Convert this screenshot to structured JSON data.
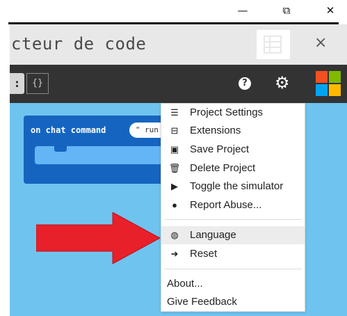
{
  "window": {
    "minimize": "—",
    "restore": "⧉",
    "close": "✕"
  },
  "header": {
    "title": "cteur de code",
    "close": "×"
  },
  "toolbar": {
    "partial_button": ":",
    "js_button": "{}",
    "help": "?"
  },
  "block": {
    "label": "on chat command",
    "value": "\" run \""
  },
  "menu": {
    "items": [
      {
        "label": "Project Settings",
        "icon": "sliders-icon"
      },
      {
        "label": "Extensions",
        "icon": "drawer-icon"
      },
      {
        "label": "Save Project",
        "icon": "floppy-icon"
      },
      {
        "label": "Delete Project",
        "icon": "trash-icon"
      },
      {
        "label": "Toggle the simulator",
        "icon": "play-box-icon"
      },
      {
        "label": "Report Abuse...",
        "icon": "alert-circle-icon"
      },
      {
        "label": "Language",
        "icon": "globe-icon"
      },
      {
        "label": "Reset",
        "icon": "sign-out-icon"
      },
      {
        "label": "About..."
      },
      {
        "label": "Give Feedback"
      }
    ],
    "highlighted": "Language"
  },
  "colors": {
    "toolbar": "#333333",
    "workspace": "#6fc4ef",
    "block": "#1565c0",
    "arrow": "#e8202a"
  }
}
